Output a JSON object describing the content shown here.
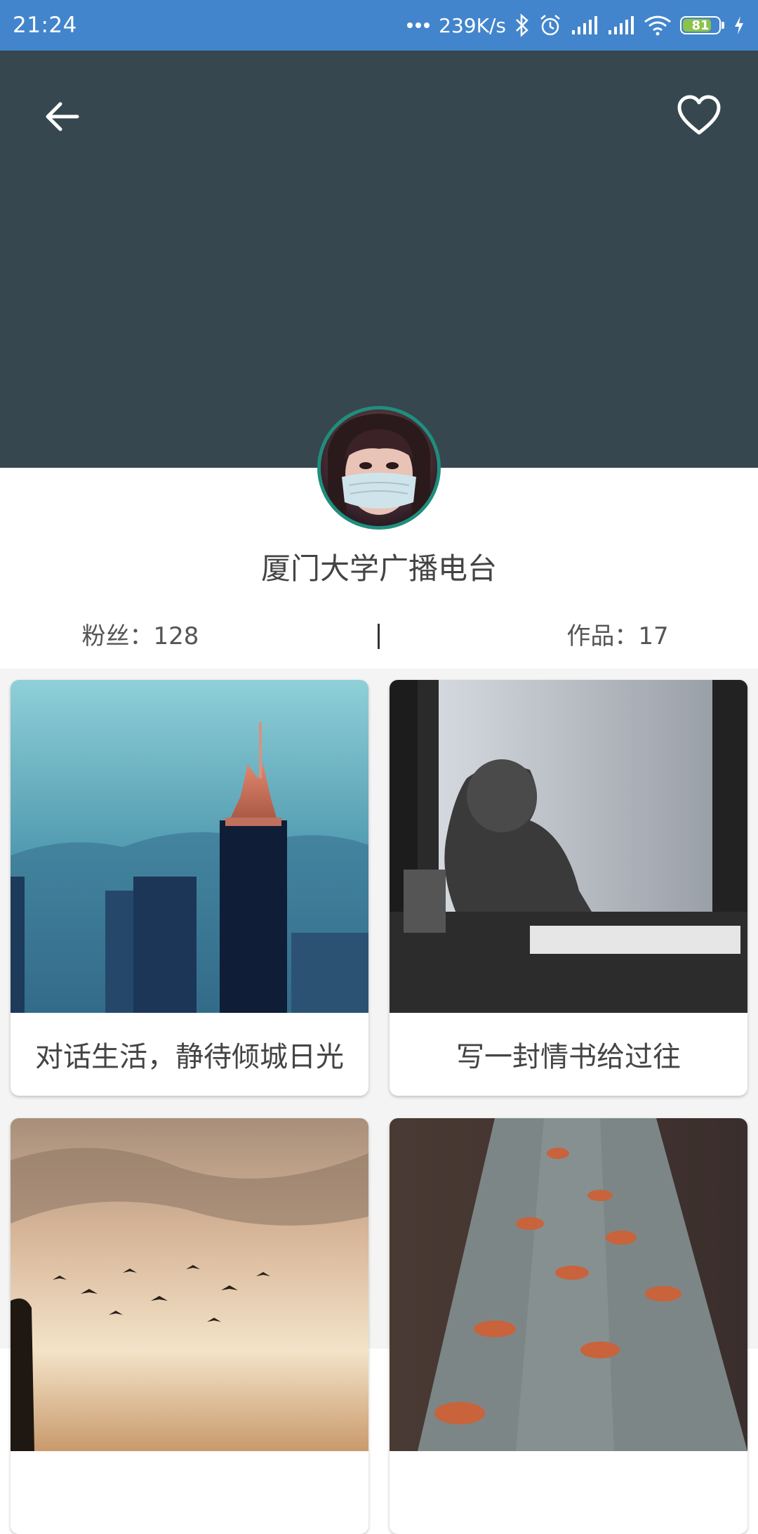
{
  "status_bar": {
    "time": "21:24",
    "net_speed": "239K/s",
    "battery": "81",
    "battery_level": 0.81,
    "icons": [
      "more-dots-icon",
      "bluetooth-icon",
      "alarm-icon",
      "signal-icon",
      "signal-icon",
      "wifi-icon",
      "battery-icon",
      "charging-icon"
    ]
  },
  "header": {
    "background_color": "#37474f",
    "back_icon": "arrow-left-icon",
    "favorite_icon": "heart-outline-icon"
  },
  "profile": {
    "name": "厦门大学广播电台",
    "fans_label": "粉丝：128",
    "works_label": "作品：17"
  },
  "works": [
    {
      "title": "对话生活，静待倾城日光",
      "image": "city-tower-photo"
    },
    {
      "title": "写一封情书给过往",
      "image": "woman-writing-photo"
    },
    {
      "title": "",
      "image": "birds-sky-photo"
    },
    {
      "title": "",
      "image": "autumn-leaves-photo"
    }
  ],
  "colors": {
    "status_bar": "#4285cc",
    "header": "#37474f",
    "avatar_border": "#1e8e7e"
  }
}
